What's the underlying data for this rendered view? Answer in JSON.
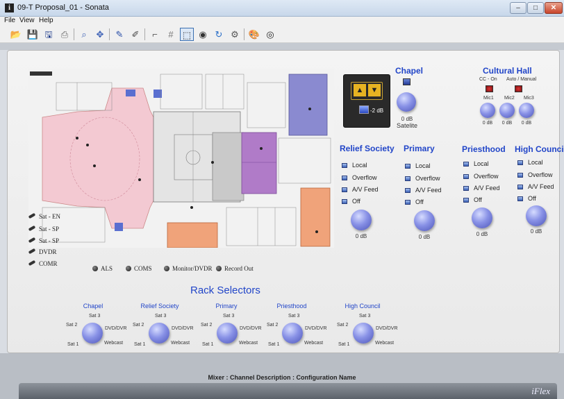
{
  "window": {
    "title": "09-T Proposal_01 - Sonata",
    "app_icon_letter": "i",
    "buttons": {
      "minimize": "–",
      "maximize": "□",
      "close": "✕"
    }
  },
  "menu": {
    "items": [
      "File",
      "View",
      "Help"
    ]
  },
  "toolbar": {
    "buttons": [
      {
        "name": "open-icon",
        "glyph": "📂"
      },
      {
        "name": "save-icon",
        "glyph": "💾"
      },
      {
        "name": "save-as-icon",
        "glyph": "🖫"
      },
      {
        "name": "print-icon",
        "glyph": "⎙"
      },
      {
        "name": "zoom-icon",
        "glyph": "⌕"
      },
      {
        "name": "pan-icon",
        "glyph": "✥"
      },
      {
        "name": "connect-icon",
        "glyph": "✎"
      },
      {
        "name": "disconnect-icon",
        "glyph": "✐"
      },
      {
        "name": "line-icon",
        "glyph": "⌐"
      },
      {
        "name": "grid-icon",
        "glyph": "#"
      },
      {
        "name": "select-icon",
        "glyph": "⬚"
      },
      {
        "name": "camera-icon",
        "glyph": "◉"
      },
      {
        "name": "rotate-icon",
        "glyph": "↻"
      },
      {
        "name": "settings-icon",
        "glyph": "⚙"
      },
      {
        "name": "palette-icon",
        "glyph": "🎨"
      },
      {
        "name": "audio-icon",
        "glyph": "◎"
      }
    ]
  },
  "legend": {
    "inputs": [
      "Sat - EN",
      "Sat - SP",
      "Sat - SP",
      "DVDR",
      "COMR"
    ],
    "outputs": [
      "ALS",
      "COMS",
      "Monitor/DVDR",
      "Record Out"
    ]
  },
  "controller": {
    "level": "-2 dB"
  },
  "chapel": {
    "title": "Chapel",
    "db": "0 dB",
    "source": "Satelite"
  },
  "cultural_hall": {
    "title": "Cultural Hall",
    "cc_on": "CC - On",
    "auto_manual": "Auto / Manual",
    "mics": [
      {
        "label": "Mic1",
        "db": "0 dB"
      },
      {
        "label": "Mic2",
        "db": "0 dB"
      },
      {
        "label": "Mic3",
        "db": "0 dB"
      }
    ]
  },
  "rooms": [
    {
      "title": "Relief Society",
      "options": [
        "Local",
        "Overflow",
        "A/V Feed",
        "Off"
      ],
      "db": "0 dB"
    },
    {
      "title": "Primary",
      "options": [
        "Local",
        "Overflow",
        "A/V Feed",
        "Off"
      ],
      "db": "0 dB"
    },
    {
      "title": "Priesthood",
      "options": [
        "Local",
        "Overflow",
        "A/V Feed",
        "Off"
      ],
      "db": "0 dB"
    },
    {
      "title": "High Council",
      "options": [
        "Local",
        "Overflow",
        "A/V Feed",
        "Off"
      ],
      "db": "0 dB"
    }
  ],
  "rack": {
    "title": "Rack Selectors",
    "selectors": [
      {
        "name": "Chapel",
        "top": "Sat 3",
        "left": "Sat 2",
        "right": "DVD/DVR",
        "bottom_left": "Sat 1",
        "bottom_right": "Webcast"
      },
      {
        "name": "Relief Society",
        "top": "Sat 3",
        "left": "Sat 2",
        "right": "DVD/DVR",
        "bottom_left": "Sat 1",
        "bottom_right": "Webcast"
      },
      {
        "name": "Primary",
        "top": "Sat 3",
        "left": "Sat 2",
        "right": "DVD/DVR",
        "bottom_left": "Sat 1",
        "bottom_right": "Webcast"
      },
      {
        "name": "Priesthood",
        "top": "Sat 3",
        "left": "Sat 2",
        "right": "DVD/DVR",
        "bottom_left": "Sat 1",
        "bottom_right": "Webcast"
      },
      {
        "name": "High Council",
        "top": "Sat 3",
        "left": "Sat 2",
        "right": "DVD/DVR",
        "bottom_left": "Sat 1",
        "bottom_right": "Webcast"
      }
    ]
  },
  "status": {
    "text": "Mixer : Channel Description : Configuration Name",
    "brand": "iFlex"
  },
  "colors": {
    "accent": "#2145c8",
    "knob": "#8891e6",
    "chapel_zone": "#f3c9d2",
    "purple_zone": "#b07bc8",
    "blue_zone": "#7f7fc8",
    "orange_zone": "#f0a37a"
  }
}
